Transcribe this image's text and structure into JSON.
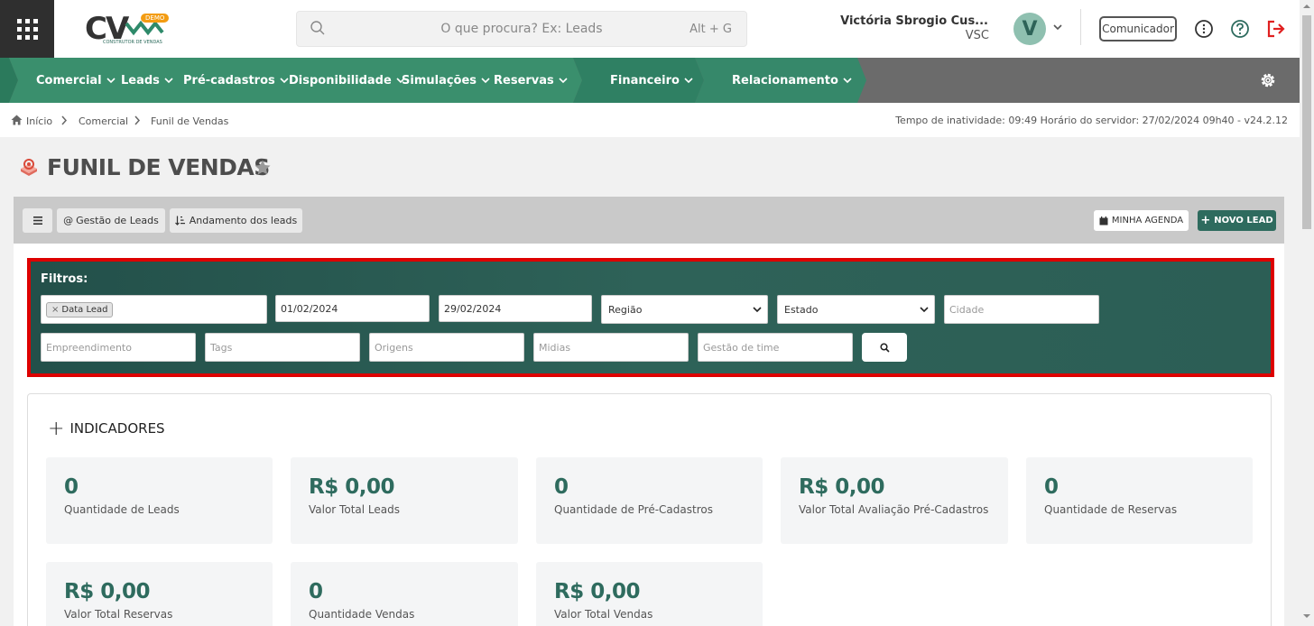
{
  "header": {
    "logo_text": "CV",
    "logo_badge": "DEMO",
    "logo_subtitle": "CONSTRUTOR DE VENDAS",
    "search_placeholder": "O que procura? Ex: Leads",
    "search_shortcut": "Alt + G",
    "user_name": "Victória Sbrogio Cus...",
    "user_org": "VSC",
    "avatar_letter": "V",
    "communicator_label": "Comunicador"
  },
  "nav": {
    "items": [
      {
        "label": "Comercial"
      },
      {
        "label": "Leads"
      },
      {
        "label": "Pré-cadastros"
      },
      {
        "label": "Disponibilidade"
      },
      {
        "label": "Simulações"
      },
      {
        "label": "Reservas"
      },
      {
        "label": "Financeiro"
      },
      {
        "label": "Relacionamento"
      }
    ]
  },
  "breadcrumb": {
    "items": [
      "Início",
      "Comercial",
      "Funil de Vendas"
    ],
    "status": "Tempo de inatividade: 09:49   Horário do servidor: 27/02/2024 09h40 - v24.2.12"
  },
  "page": {
    "title": "FUNIL DE VENDAS"
  },
  "toolbar": {
    "leads_mgmt_label": "Gestão de Leads",
    "leads_progress_label": "Andamento dos leads",
    "agenda_label": "MINHA AGENDA",
    "new_lead_label": "NOVO LEAD"
  },
  "filters": {
    "label": "Filtros:",
    "date_type_tag": "Data Lead",
    "date_from": "01/02/2024",
    "date_to": "29/02/2024",
    "region_selected": "Região",
    "state_selected": "Estado",
    "city_placeholder": "Cidade",
    "development_placeholder": "Empreendimento",
    "tags_placeholder": "Tags",
    "origins_placeholder": "Origens",
    "media_placeholder": "Midias",
    "team_placeholder": "Gestão de time"
  },
  "indicators": {
    "title": "INDICADORES",
    "cards": [
      {
        "value": "0",
        "label": "Quantidade de Leads"
      },
      {
        "value": "R$ 0,00",
        "label": "Valor Total Leads"
      },
      {
        "value": "0",
        "label": "Quantidade de Pré-Cadastros"
      },
      {
        "value": "R$ 0,00",
        "label": "Valor Total Avaliação Pré-Cadastros"
      },
      {
        "value": "0",
        "label": "Quantidade de Reservas"
      },
      {
        "value": "R$ 0,00",
        "label": "Valor Total Reservas"
      },
      {
        "value": "0",
        "label": "Quantidade Vendas"
      },
      {
        "value": "R$ 0,00",
        "label": "Valor Total Vendas"
      }
    ]
  },
  "colors": {
    "brand_green": "#2e6b5e",
    "nav_green": "#3a8a6c",
    "highlight_border": "#dd0000",
    "exit_red": "#e02020"
  }
}
